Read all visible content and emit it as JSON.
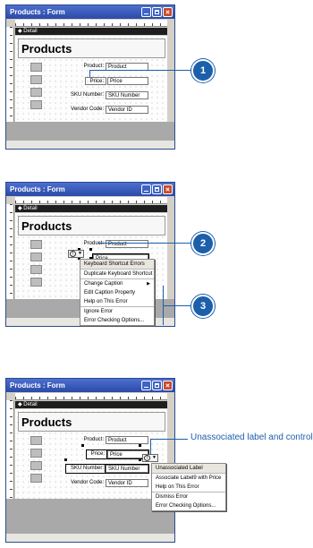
{
  "window": {
    "title": "Products : Form",
    "section": "Detail",
    "header_text": "Products"
  },
  "fields": {
    "product": {
      "label": "Product:",
      "value": "Product"
    },
    "price": {
      "label": "Price:",
      "value": "Price"
    },
    "sku": {
      "label": "SKU Number:",
      "value": "SKU Number"
    },
    "vendor": {
      "label": "Vendor Code:",
      "value": "Vendor ID"
    }
  },
  "callouts": {
    "one": "1",
    "two": "2",
    "three": "3",
    "unassoc": "Unassociated label and control"
  },
  "menu1": {
    "items": [
      "Keyboard Shortcut Errors",
      "Duplicate Keyboard Shortcut",
      "Change Caption",
      "Edit Caption Property",
      "Help on This Error",
      "Ignore Error",
      "Error Checking Options..."
    ]
  },
  "menu2": {
    "items": [
      "Unassociated Label",
      "Associate Label9 with Price",
      "Help on This Error",
      "Dismiss Error",
      "Error Checking Options..."
    ]
  },
  "colors": {
    "accent": "#1c5fab",
    "titlebar": "#2a4aa7"
  }
}
